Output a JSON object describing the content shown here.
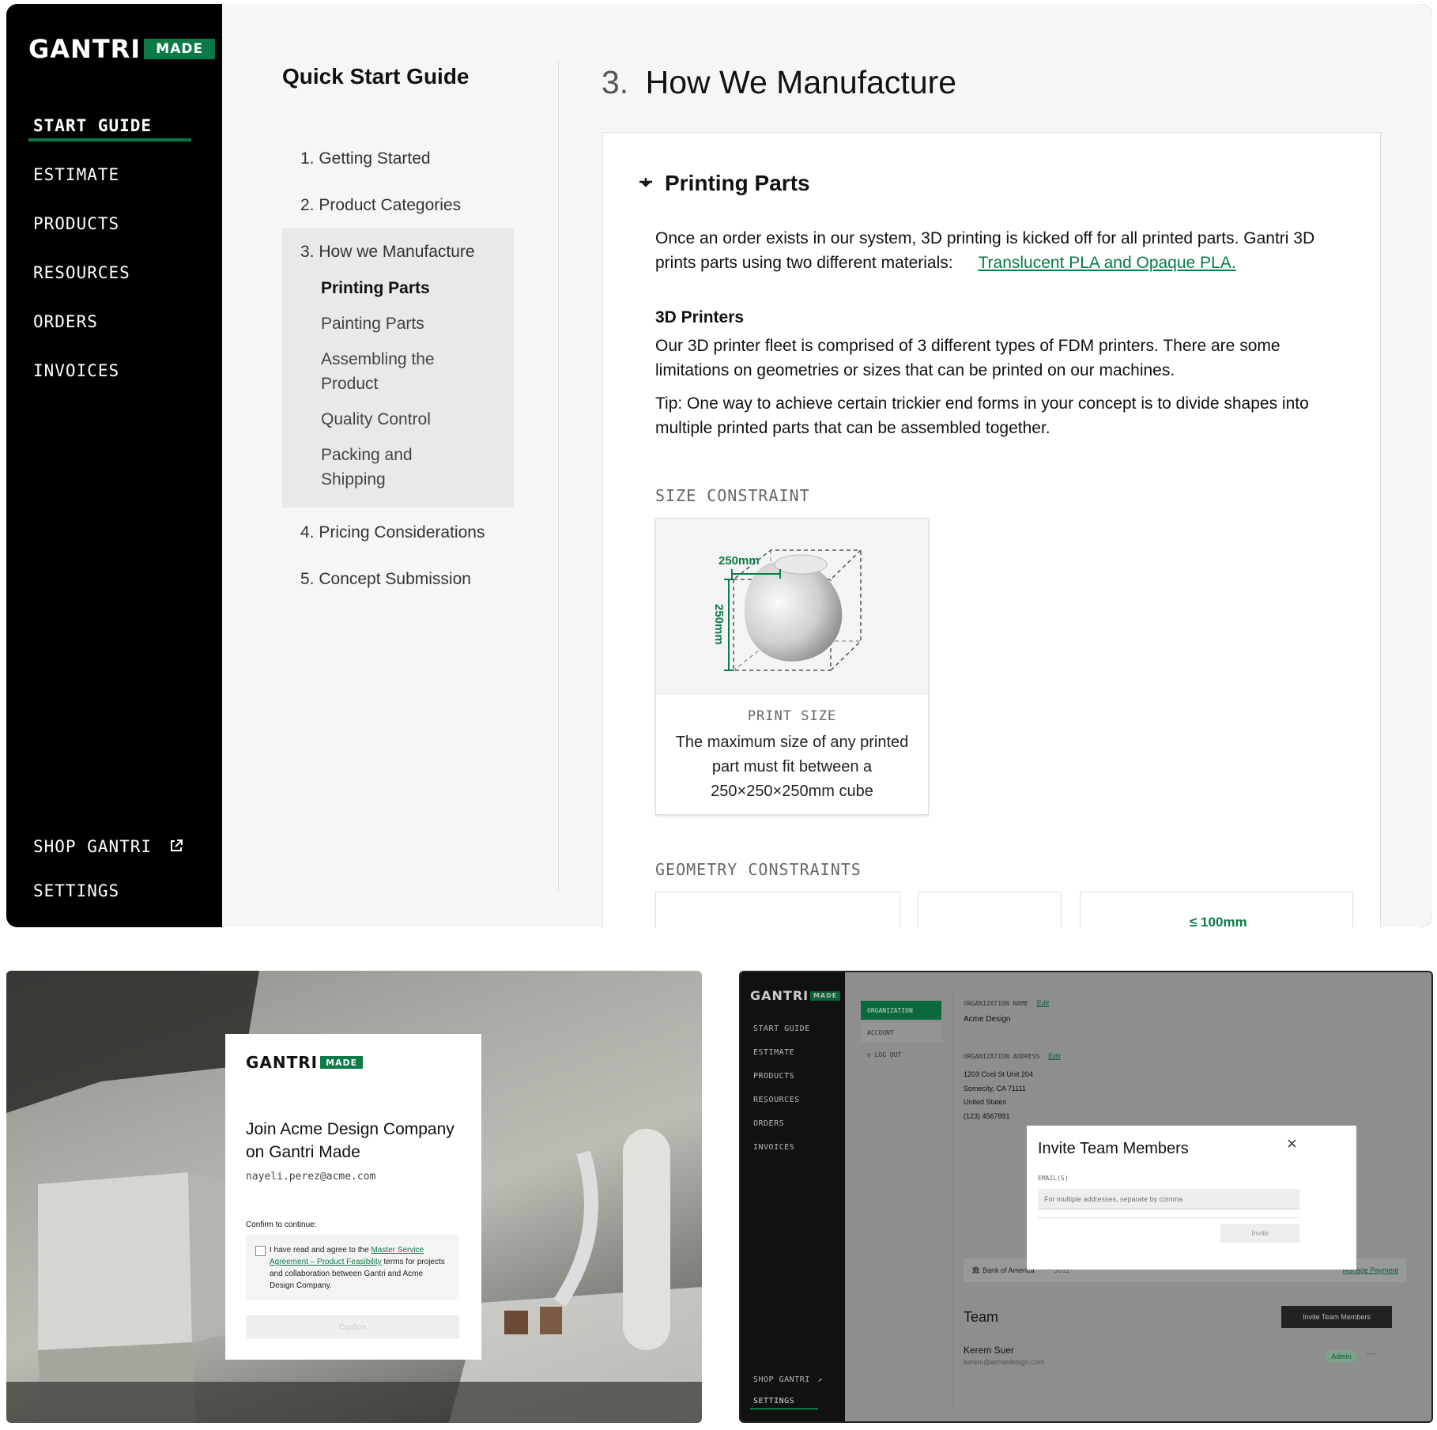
{
  "brand": {
    "word": "GANTRI",
    "made": "MADE"
  },
  "top": {
    "nav": [
      "START GUIDE",
      "ESTIMATE",
      "PRODUCTS",
      "RESOURCES",
      "ORDERS",
      "INVOICES"
    ],
    "bottom_nav": {
      "shop": "SHOP GANTRI",
      "settings": "SETTINGS"
    },
    "guide": {
      "title": "Quick Start Guide",
      "items": [
        "1. Getting Started",
        "2. Product Categories",
        "3. How we Manufacture",
        "4. Pricing Considerations",
        "5. Concept Submission"
      ],
      "subitems": [
        "Printing Parts",
        "Painting Parts",
        "Assembling the Product",
        "Quality Control",
        "Packing and Shipping"
      ]
    },
    "section": {
      "number": "3.",
      "title": "How We Manufacture",
      "heading": "Printing Parts",
      "intro": "Once an order exists in our system, 3D printing is kicked off for all printed parts. Gantri 3D prints parts using two different materials:",
      "intro_link": "Translucent PLA and Opaque PLA.",
      "printers_heading": "3D Printers",
      "printers_text": "Our 3D printer fleet is comprised of 3 different types of FDM printers.  There are some limitations on geometries or sizes that can be printed on our machines.",
      "tip": "Tip: One way to achieve certain trickier end forms in your concept is to divide shapes into multiple printed parts that can be assembled together.",
      "size_label": "SIZE CONSTRAINT",
      "dim_top": "250mm",
      "dim_side": "250mm",
      "print_size_label": "PRINT SIZE",
      "print_size_text": "The maximum size of any printed part must fit between a 250×250×250mm cube",
      "geometry_label": "GEOMETRY CONSTRAINTS",
      "geo_dim": "≤ 100mm"
    }
  },
  "join": {
    "title": "Join Acme Design Company on Gantri Made",
    "email": "nayeli.perez@acme.com",
    "confirm_label": "Confirm to continue:",
    "agree_prefix": "I have read and agree to the",
    "agree_link": "Master Service Agreement – Product Feasibility",
    "agree_suffix": "terms for projects and collaboration between Gantri and Acme Design Company.",
    "button": "Confirm"
  },
  "settings": {
    "nav": [
      "START GUIDE",
      "ESTIMATE",
      "PRODUCTS",
      "RESOURCES",
      "ORDERS",
      "INVOICES"
    ],
    "bottom_nav": {
      "shop": "SHOP GANTRI",
      "settings": "SETTINGS"
    },
    "tabs": {
      "organization": "ORGANIZATION",
      "account": "ACCOUNT",
      "logout": "LOG OUT"
    },
    "org_name_label": "ORGANIZATION NAME",
    "org_addr_label": "ORGANIZATION ADDRESS",
    "edit": "Edit",
    "org_name": "Acme Design",
    "address": [
      "1203 Cool St Unit 204",
      "Somecity, CA 71111",
      "United States",
      "(123) 4567891"
    ],
    "bank": "Bank of America",
    "bank_mask": "**** 3012",
    "manage_payment": "Manage Payment",
    "team_title": "Team",
    "invite_button": "Invite Team Members",
    "member_name": "Kerem Suer",
    "member_email": "kerem@acmedesign.com",
    "member_role": "Admin",
    "more": "···",
    "modal": {
      "title": "Invite Team Members",
      "email_label": "EMAIL(S)",
      "placeholder": "For multiple addresses, separate by comma",
      "button": "Invite",
      "close": "×"
    }
  },
  "colors": {
    "brand_green": "#0a7b46",
    "sidebar": "#000000",
    "content_bg": "#f6f6f6"
  }
}
